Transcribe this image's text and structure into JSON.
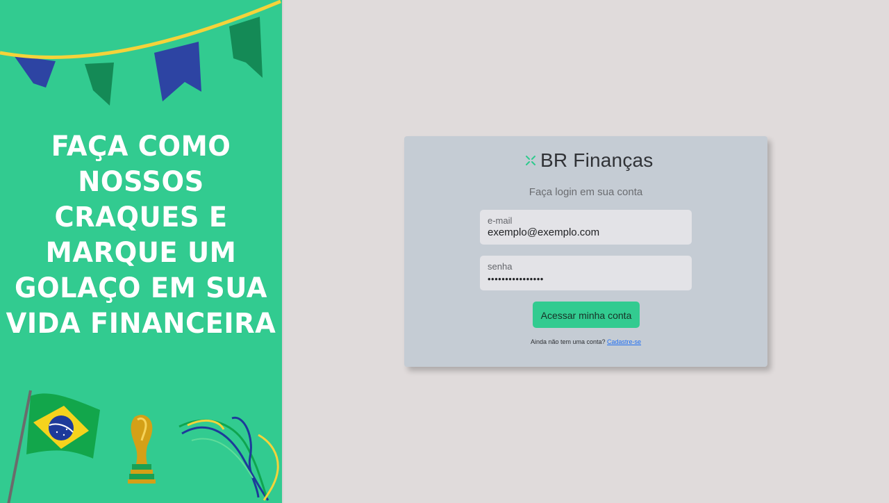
{
  "colors": {
    "banner_bg": "#32cb90",
    "page_bg": "#e0dbdb",
    "card_bg": "#c5ccd4",
    "button_bg": "#32cb90",
    "link": "#1f6ef2"
  },
  "banner": {
    "headline": "Faça como nossos craques e marque um golaço em sua vida financeira",
    "icons": [
      "bunting-icon",
      "brazil-flag-icon",
      "trophy-icon",
      "ribbon-icon"
    ]
  },
  "login": {
    "brand": "BR Finanças",
    "brand_icon": "cross-logo-icon",
    "subtitle": "Faça login em sua conta",
    "email_label": "e-mail",
    "email_value": "exemplo@exemplo.com",
    "password_label": "senha",
    "password_mask": "••••••••••••••••",
    "submit_label": "Acessar minha conta",
    "signup_prompt": "Ainda não tem uma conta?",
    "signup_link": "Cadastre-se"
  }
}
